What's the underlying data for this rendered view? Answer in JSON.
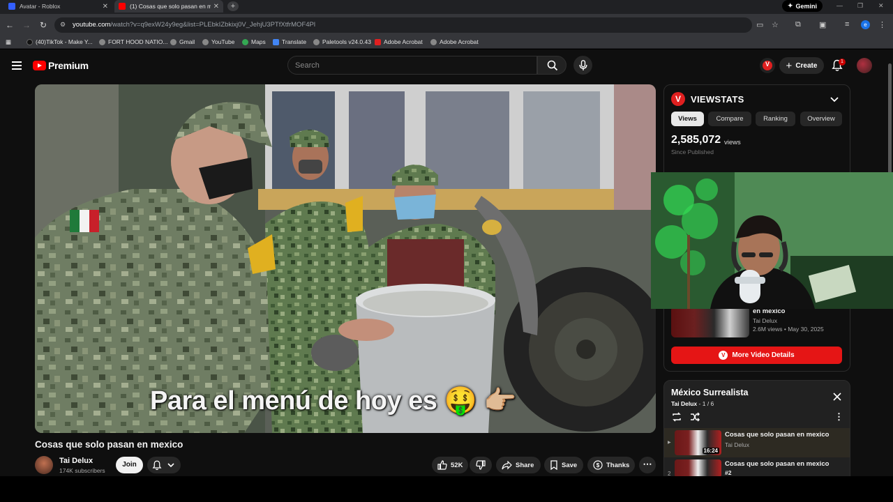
{
  "browser": {
    "tabs": [
      {
        "title": "Avatar - Roblox",
        "active": false
      },
      {
        "title": "(1) Cosas que solo pasan en me",
        "active": true
      }
    ],
    "gemini_label": "Gemini",
    "url_host": "youtube.com",
    "url_path": "/watch?v=q9exW24y9eg&list=PLEbkIZbkixj0V_JehjU3PTfXtfrMOF4Pl",
    "profile_initial": "e",
    "bookmarks": [
      "(40)TikTok - Make Y...",
      "FORT HOOD NATIO...",
      "Gmail",
      "YouTube",
      "Maps",
      "Translate",
      "Paletools v24.0.43",
      "Adobe Acrobat",
      "Adobe Acrobat"
    ]
  },
  "header": {
    "logo_text": "Premium",
    "search_placeholder": "Search",
    "create_label": "Create",
    "notification_count": "1",
    "viewstats_letter": "V"
  },
  "video": {
    "caption": "Para el menú de hoy es 🤑 👉🏼",
    "title": "Cosas que solo pasan en mexico",
    "channel": "Tai Delux",
    "subscribers": "174K subscribers",
    "join_label": "Join",
    "likes": "52K",
    "share_label": "Share",
    "save_label": "Save",
    "thanks_label": "Thanks"
  },
  "viewstats": {
    "logo_letter": "V",
    "title": "VIEWSTATS",
    "tabs": [
      "Views",
      "Compare",
      "Ranking",
      "Overview"
    ],
    "views_count": "2,585,072",
    "views_label": "views",
    "since_label": "Since Published",
    "related": {
      "title": "en mexico",
      "channel": "Tai Delux",
      "meta": "2.6M views • May 30, 2025"
    },
    "more_details_label": "More Video Details"
  },
  "playlist": {
    "title": "México Surrealista",
    "owner": "Tai Delux",
    "position": "1 / 6",
    "items": [
      {
        "title": "Cosas que solo pasan en mexico",
        "channel": "Tai Delux",
        "duration": "16:24",
        "index": ""
      },
      {
        "title": "Cosas que solo pasan en mexico",
        "channel": "#2",
        "duration": "",
        "index": "2"
      }
    ]
  },
  "colors": {
    "youtube_red": "#ff0000",
    "viewstats_red": "#e51515",
    "background": "#0f0f0f"
  }
}
